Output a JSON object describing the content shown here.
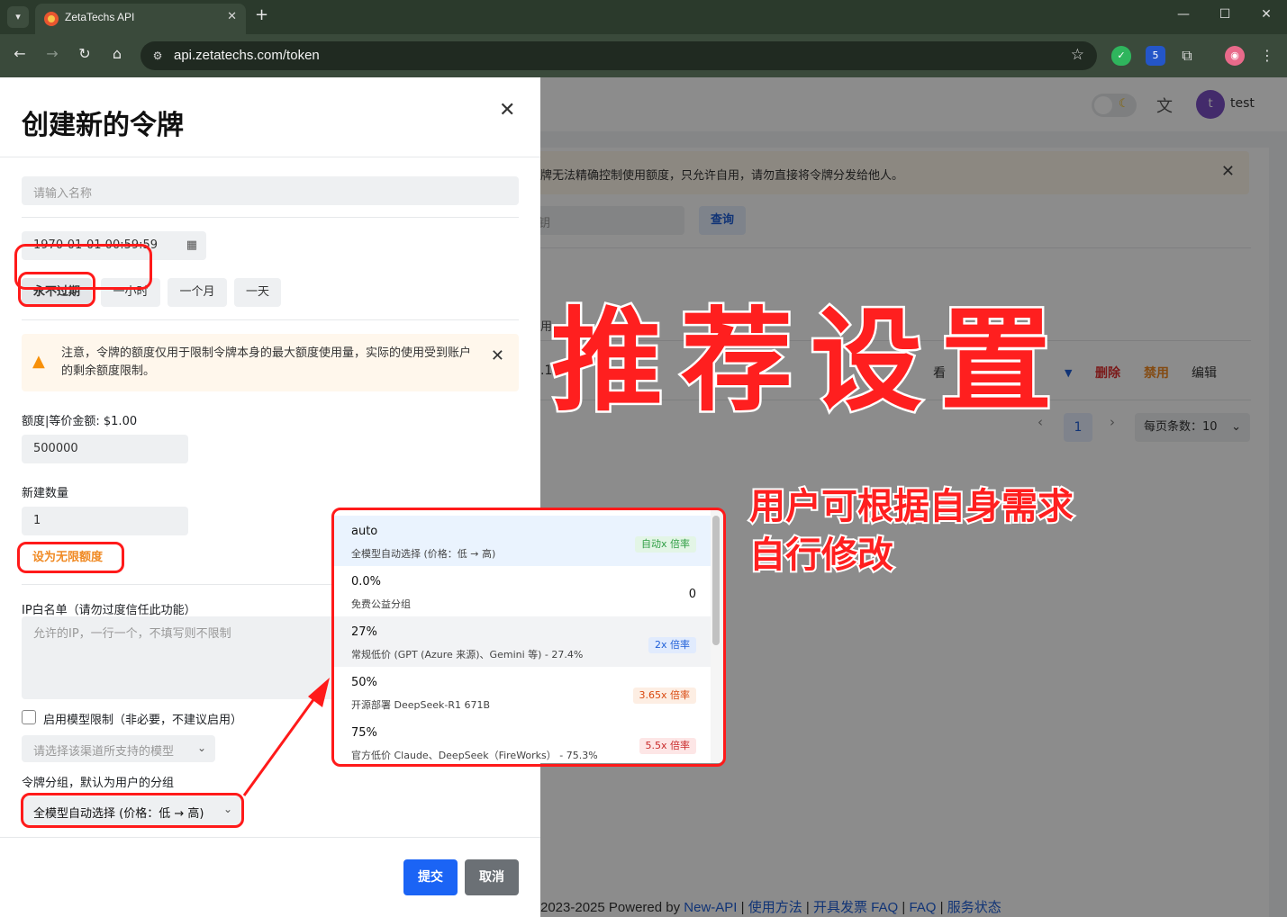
{
  "browser": {
    "tab_title": "ZetaTechs API",
    "url": "api.zetatechs.com/token",
    "extension_badge": "5"
  },
  "header": {
    "user_initial": "t",
    "user_name": "test"
  },
  "background": {
    "warning_text": "牌无法精确控制使用额度，只允许自用，请勿直接将令牌分发给他人。",
    "search_placeholder": "钥",
    "query_button": "查询",
    "table_head_fragment": "用",
    "row_fragment": ".11",
    "row_view": "看",
    "row_delete": "删除",
    "row_disable": "禁用",
    "row_edit": "编辑",
    "page_current": "1",
    "per_page": "每页条数：10"
  },
  "footer": {
    "prefix": "2023-2025 Powered by",
    "links": [
      "New-API",
      "使用方法",
      "开具发票 FAQ",
      "FAQ",
      "服务状态"
    ],
    "separator": "|"
  },
  "drawer": {
    "title": "创建新的令牌",
    "name_placeholder": "请输入名称",
    "expire_value": "1970-01-01 00:59:59",
    "expire_chips": [
      "永不过期",
      "一小时",
      "一个月",
      "一天"
    ],
    "alert_text": "注意，令牌的额度仅用于限制令牌本身的最大额度使用量，实际的使用受到账户的剩余额度限制。",
    "quota_label": "额度|等价金额: $1.00",
    "quota_value": "500000",
    "count_label": "新建数量",
    "count_value": "1",
    "unlimited_button": "设为无限额度",
    "ip_label": "IP白名单（请勿过度信任此功能）",
    "ip_placeholder": "允许的IP，一行一个，不填写则不限制",
    "model_limit_label": "启用模型限制（非必要，不建议启用）",
    "model_placeholder": "请选择该渠道所支持的模型",
    "group_label": "令牌分组，默认为用户的分组",
    "group_value": "全模型自动选择 (价格：低 → 高)",
    "submit": "提交",
    "cancel": "取消"
  },
  "group_options": [
    {
      "title": "auto",
      "desc": "全模型自动选择 (价格：低 → 高)",
      "badge": "自动x 倍率",
      "badge_color": "#2f9e44",
      "badge_bg": "#e3f5e6",
      "selected": true
    },
    {
      "title": "0.0%",
      "desc": "免费公益分组",
      "value": "0"
    },
    {
      "title": "27%",
      "desc": "常规低价 (GPT (Azure 来源)、Gemini 等) - 27.4%",
      "badge": "2x 倍率",
      "badge_color": "#1f5fd8",
      "badge_bg": "#e1ebfd"
    },
    {
      "title": "50%",
      "desc": "开源部署 DeepSeek-R1 671B",
      "badge": "3.65x 倍率",
      "badge_color": "#d9480f",
      "badge_bg": "#fdeee3"
    },
    {
      "title": "75%",
      "desc": "官方低价 Claude、DeepSeek（FireWorks） - 75.3%",
      "badge": "5.5x 倍率",
      "badge_color": "#c92a2a",
      "badge_bg": "#fde6e6"
    }
  ],
  "annotations": {
    "headline": "推荐设置",
    "note_line1": "用户可根据自身需求",
    "note_line2": "自行修改"
  },
  "colors": {
    "accent": "#1b64f5",
    "annotation_red": "#ff1a1a",
    "warning_orange": "#f08a24"
  }
}
